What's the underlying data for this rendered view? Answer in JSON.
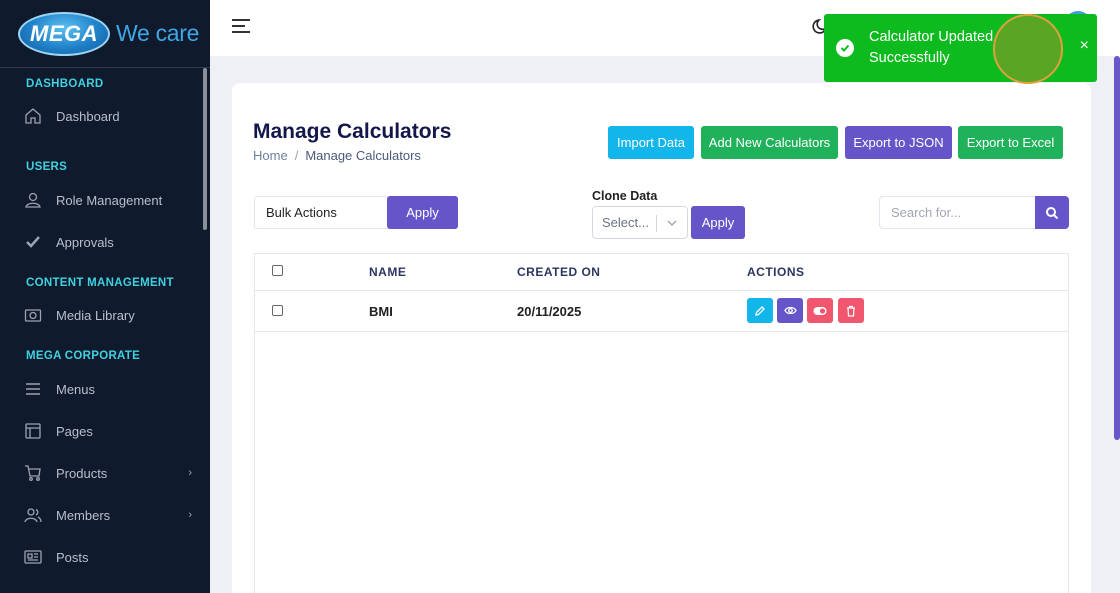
{
  "brand": {
    "logo_text": "MEGA",
    "tagline": "We care"
  },
  "sidebar": {
    "sections": [
      {
        "title": "DASHBOARD",
        "items": [
          {
            "label": "Dashboard",
            "icon": "home-icon"
          }
        ]
      },
      {
        "title": "USERS",
        "items": [
          {
            "label": "Role Management",
            "icon": "user-icon"
          },
          {
            "label": "Approvals",
            "icon": "check-icon"
          }
        ]
      },
      {
        "title": "CONTENT MANAGEMENT",
        "items": [
          {
            "label": "Media Library",
            "icon": "camera-icon"
          }
        ]
      },
      {
        "title": "MEGA CORPORATE",
        "items": [
          {
            "label": "Menus",
            "icon": "menu-icon"
          },
          {
            "label": "Pages",
            "icon": "layout-icon"
          },
          {
            "label": "Products",
            "icon": "cart-icon"
          },
          {
            "label": "Members",
            "icon": "users-icon"
          },
          {
            "label": "Posts",
            "icon": "newspaper-icon"
          }
        ]
      }
    ]
  },
  "main": {
    "title": "Manage Calculators",
    "breadcrumb": {
      "home": "Home",
      "separator": "/",
      "current": "Manage Calculators"
    },
    "buttons": {
      "import": "Import Data",
      "add": "Add New Calculators",
      "export_json": "Export to JSON",
      "export_excel": "Export to Excel"
    },
    "bulk": {
      "value": "Bulk Actions",
      "apply": "Apply"
    },
    "clone": {
      "label": "Clone Data",
      "placeholder": "Select...",
      "apply": "Apply"
    },
    "search": {
      "placeholder": "Search for..."
    },
    "table": {
      "headers": [
        "NAME",
        "CREATED ON",
        "ACTIONS"
      ],
      "rows": [
        {
          "name": "BMI",
          "created_on": "20/11/2025"
        }
      ]
    }
  },
  "toast": {
    "message": "Calculator Updated Successfully",
    "close": "×"
  },
  "colors": {
    "sidebar_bg": "#0f1b2d",
    "accent_purple": "#6655c9",
    "green": "#1fb25a",
    "cyan": "#12b6ea",
    "toast_green": "#0ebb1f",
    "danger_pink": "#f0566e"
  }
}
